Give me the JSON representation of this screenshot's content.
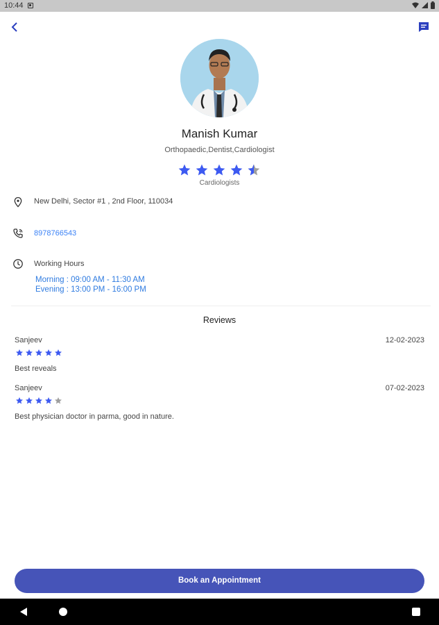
{
  "status_bar": {
    "time": "10:44"
  },
  "doctor": {
    "name": "Manish Kumar",
    "specialties": "Orthopaedic,Dentist,Cardiologist",
    "rating": 4.5,
    "rating_caption": "Cardiologists",
    "address": "New Delhi, Sector #1 , 2nd Floor, 110034",
    "phone": "8978766543",
    "working_hours_label": "Working Hours",
    "hours_morning": "Morning : 09:00 AM - 11:30 AM",
    "hours_evening": "Evening : 13:00 PM - 16:00 PM"
  },
  "reviews": {
    "title": "Reviews",
    "items": [
      {
        "name": "Sanjeev",
        "date": "12-02-2023",
        "rating": 5,
        "text": "Best reveals"
      },
      {
        "name": "Sanjeev",
        "date": "07-02-2023",
        "rating": 4,
        "text": "Best physician doctor in parma, good in nature."
      }
    ]
  },
  "book_button_label": "Book an Appointment",
  "colors": {
    "accent": "#4654b8",
    "star": "#3d5af1",
    "star_empty": "#9e9e9e",
    "link": "#3b82f6"
  },
  "icons": [
    "back-arrow-icon",
    "chat-icon",
    "location-icon",
    "phone-icon",
    "clock-icon",
    "star-icon"
  ]
}
